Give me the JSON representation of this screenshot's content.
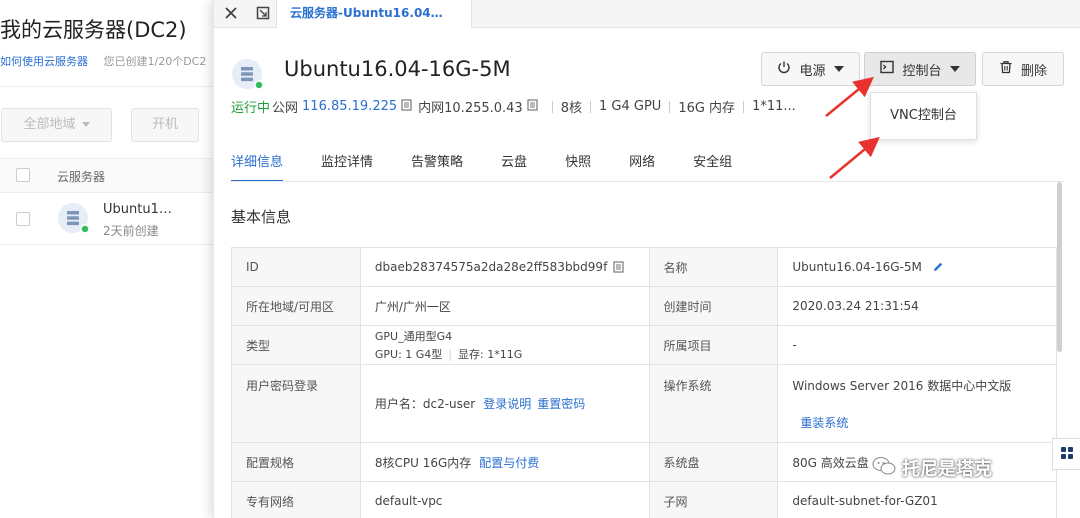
{
  "background": {
    "title": "我的云服务器(DC2)",
    "help_link": "如何使用云服务器",
    "quota_text": "您已创建1/20个DC2",
    "region_filter": "全部地域",
    "power_on_button": "开机",
    "table_header": "云服务器",
    "rows": [
      {
        "name": "Ubuntu1…",
        "created": "2天前创建"
      }
    ]
  },
  "drawer": {
    "tab_title": "云服务器-Ubuntu16.04…",
    "server_name": "Ubuntu16.04-16G-5M",
    "actions": {
      "power": "电源",
      "console": "控制台",
      "delete": "删除"
    },
    "console_menu": [
      "VNC控制台"
    ],
    "status_line": {
      "status": "运行中",
      "public_label": "公网",
      "public_ip": "116.85.19.225",
      "private": "内网10.255.0.43",
      "cpu": "8核",
      "gpu": "1 G4 GPU",
      "mem": "16G 内存",
      "more": "1*11..."
    },
    "tabs": [
      "详细信息",
      "监控详情",
      "告警策略",
      "云盘",
      "快照",
      "网络",
      "安全组"
    ],
    "active_tab": "详细信息",
    "section_title": "基本信息",
    "details": {
      "id_label": "ID",
      "id_value": "dbaeb28374575a2da28e2ff583bbd99f",
      "name_label": "名称",
      "name_value": "Ubuntu16.04-16G-5M",
      "region_label": "所在地域/可用区",
      "region_value": "广州/广州一区",
      "created_label": "创建时间",
      "created_value": "2020.03.24 21:31:54",
      "type_label": "类型",
      "type_value": "GPU_通用型G4",
      "type_gpu": "GPU: 1 G4型",
      "type_vram": "显存: 1*11G",
      "project_label": "所属项目",
      "project_value": "-",
      "login_label": "用户密码登录",
      "login_user": "用户名：dc2-user",
      "login_help": "登录说明",
      "login_reset": "重置密码",
      "os_label": "操作系统",
      "os_value": "Windows Server 2016 数据中心中文版",
      "os_reinstall": "重装系统",
      "spec_label": "配置规格",
      "spec_value": "8核CPU 16G内存",
      "spec_link": "配置与付费",
      "sysdisk_label": "系统盘",
      "sysdisk_value": "80G 高效云盘",
      "vpc_label": "专有网络",
      "vpc_value": "default-vpc",
      "subnet_label": "子网",
      "subnet_value": "default-subnet-for-GZ01"
    }
  },
  "watermark": "托尼是塔克",
  "colors": {
    "accent": "#2a6fd1",
    "running": "#1f9e3a",
    "annotation_arrow": "#e8322d"
  }
}
